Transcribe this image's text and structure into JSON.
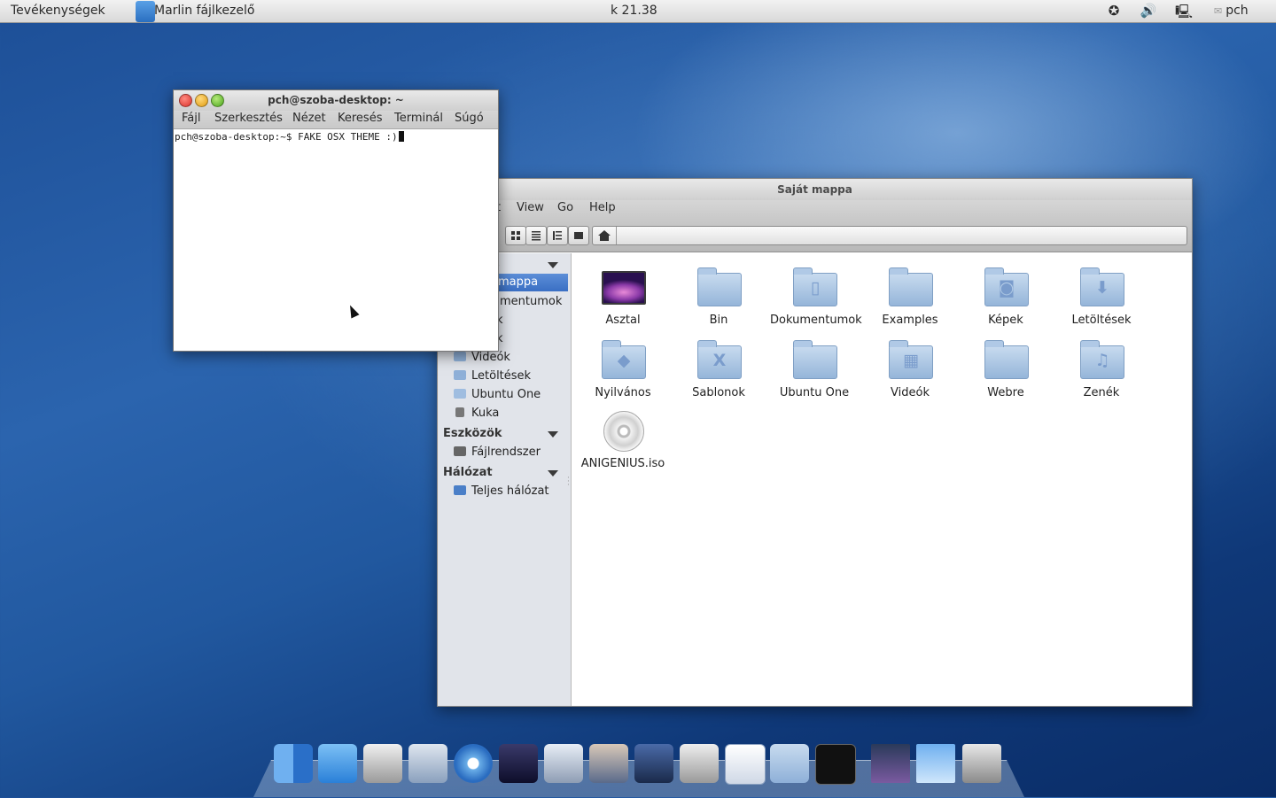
{
  "topbar": {
    "activities": "Tevékenységek",
    "app_name": "Marlin fájlkezelő",
    "clock": "k 21.38",
    "user": "pch",
    "tray_icons": [
      "accessibility-icon",
      "volume-icon",
      "network-icon",
      "chat-status-icon"
    ]
  },
  "terminal": {
    "title": "pch@szoba-desktop: ~",
    "menu": [
      "Fájl",
      "Szerkesztés",
      "Nézet",
      "Keresés",
      "Terminál",
      "Súgó"
    ],
    "prompt": "pch@szoba-desktop:~$ FAKE OSX THEME :)"
  },
  "filemanager": {
    "title": "Saját mappa",
    "menu_visible": [
      "t",
      "View",
      "Go",
      "Help"
    ],
    "sidebar": {
      "section1_fragment": "s",
      "selected_fragment": "mappa",
      "items_fragments": [
        "mentumok",
        "k",
        "k"
      ],
      "items": [
        "Videók",
        "Letöltések",
        "Ubuntu One",
        "Kuka"
      ],
      "tools_header": "Eszközök",
      "tools_items": [
        "Fájlrendszer"
      ],
      "network_header": "Hálózat",
      "network_items": [
        "Teljes hálózat"
      ]
    },
    "files": [
      {
        "name": "Asztal",
        "type": "desktop"
      },
      {
        "name": "Bin",
        "type": "folder"
      },
      {
        "name": "Dokumentumok",
        "type": "folder"
      },
      {
        "name": "Examples",
        "type": "folder"
      },
      {
        "name": "Képek",
        "type": "folder"
      },
      {
        "name": "Letöltések",
        "type": "folder"
      },
      {
        "name": "Nyilvános",
        "type": "folder"
      },
      {
        "name": "Sablonok",
        "type": "folder"
      },
      {
        "name": "Ubuntu One",
        "type": "folder"
      },
      {
        "name": "Videók",
        "type": "folder"
      },
      {
        "name": "Webre",
        "type": "folder"
      },
      {
        "name": "Zenék",
        "type": "folder"
      },
      {
        "name": "ANIGENIUS.iso",
        "type": "disc"
      }
    ]
  },
  "dock": {
    "apps": [
      "finder-icon",
      "marlin-icon",
      "binary-settings-icon",
      "mail-icon",
      "safari-icon",
      "imovie-icon",
      "camera-icon",
      "photo-booth-icon",
      "photos-icon",
      "calculator-icon",
      "text-editor-icon",
      "utilities-folder-icon",
      "terminal-icon",
      "desktop-preview-icon",
      "blank-window-icon",
      "trash-icon"
    ]
  }
}
